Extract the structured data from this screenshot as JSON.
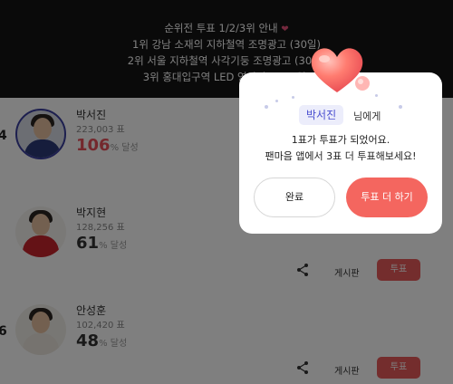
{
  "banner": {
    "line1": "순위전 투표 1/2/3위 안내",
    "line2": "1위 강남 소재의 지하철역 조명광고 (30일)",
    "line3": "2위 서울 지하철역 사각기둥 조명광고 (30일)",
    "line4": "3위 홍대입구역 LED 영상광고 (30일)"
  },
  "list": {
    "unit": "% 달성",
    "board_label": "게시판",
    "vote_label": "투표",
    "rows": [
      {
        "name": "박서진",
        "votes": "223,003 표",
        "percent": "106"
      },
      {
        "name": "박지현",
        "votes": "128,256 표",
        "percent": "61"
      },
      {
        "name": "안성훈",
        "votes": "102,420 표",
        "percent": "48"
      }
    ]
  },
  "modal": {
    "candidate": "박서진",
    "suffix": "님에게",
    "message1": "1표가 투표가 되었어요.",
    "message2": "팬마음 앱에서 3표 더 투표해보세요!",
    "done_label": "완료",
    "more_label": "투표 더 하기"
  },
  "colors": {
    "accent": "#f4665f",
    "name_chip_text": "#4a4fd0",
    "highlight_percent": "#e8505a"
  },
  "icons": [
    "heart-icon",
    "share-icon",
    "heart-emoji-icon"
  ]
}
